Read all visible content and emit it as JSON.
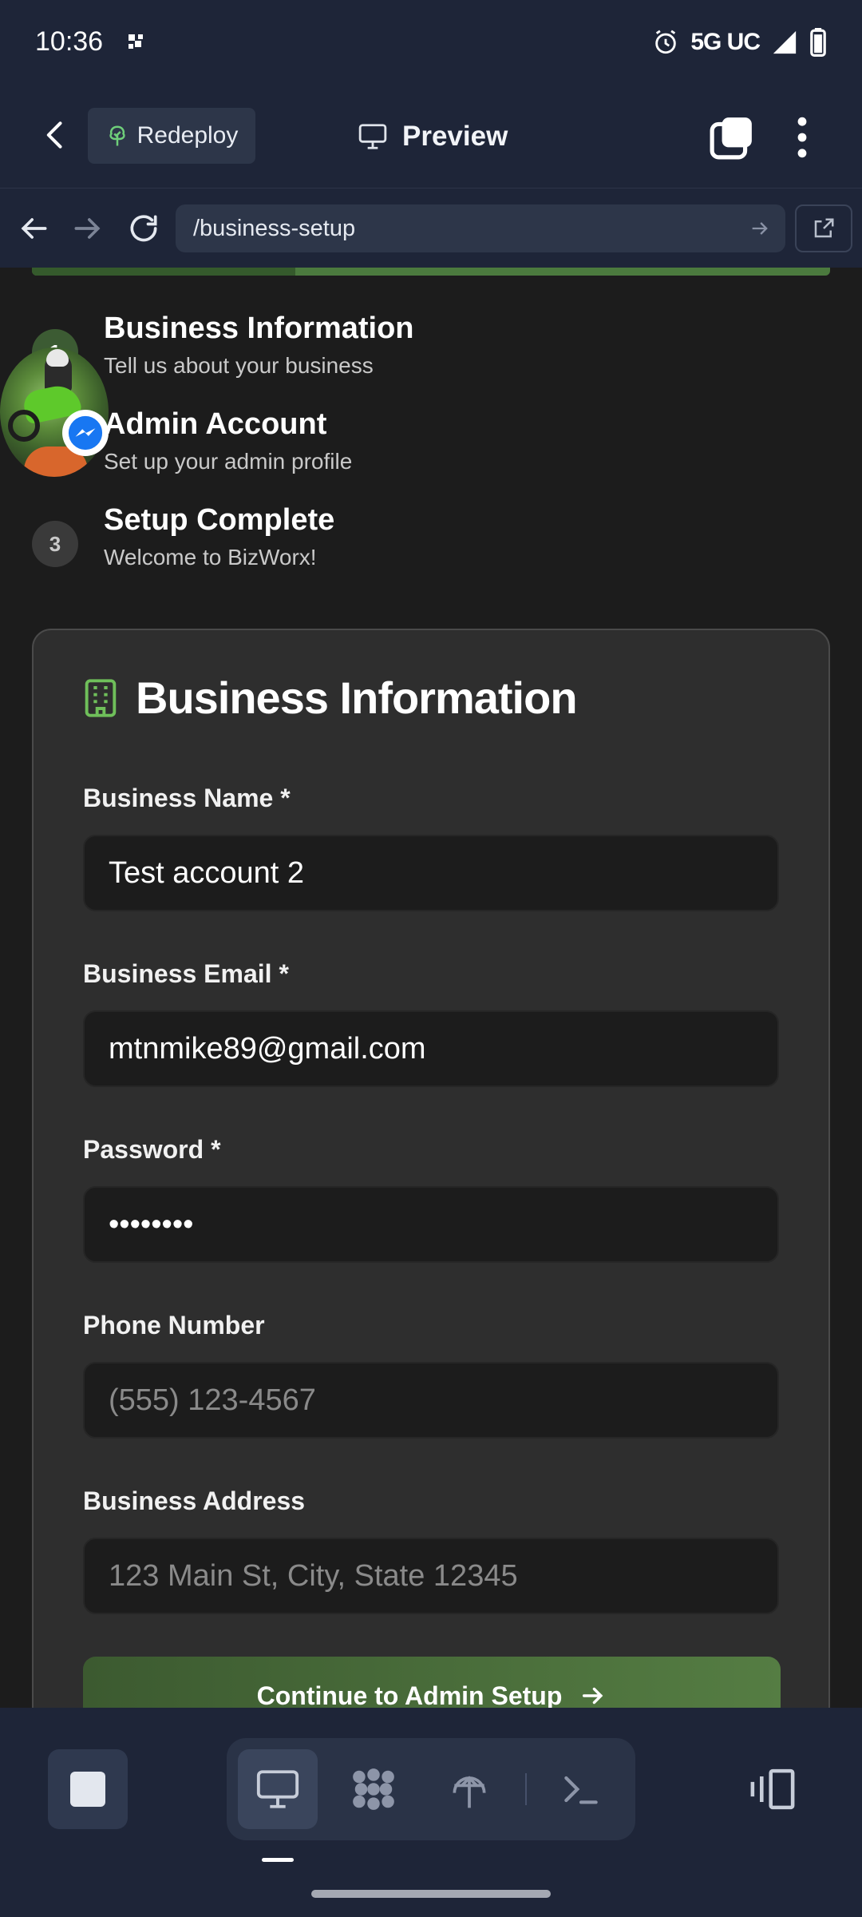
{
  "status_bar": {
    "time": "10:36",
    "network": "5G UC",
    "icons": [
      "notification-dot-icon",
      "alarm-icon",
      "signal-icon",
      "battery-icon"
    ]
  },
  "toolbar": {
    "redeploy_label": "Redeploy",
    "preview_label": "Preview"
  },
  "url_bar": {
    "url": "/business-setup"
  },
  "progress": {
    "fraction": 0.33
  },
  "steps": [
    {
      "number": "1",
      "title": "Business Information",
      "subtitle": "Tell us about your business"
    },
    {
      "number": "2",
      "title": "Admin Account",
      "subtitle": "Set up your admin profile"
    },
    {
      "number": "3",
      "title": "Setup Complete",
      "subtitle": "Welcome to BizWorx!"
    }
  ],
  "form": {
    "title": "Business Information",
    "fields": {
      "business_name": {
        "label": "Business Name *",
        "value": "Test account 2"
      },
      "business_email": {
        "label": "Business Email *",
        "value": "mtnmike89@gmail.com"
      },
      "password": {
        "label": "Password *",
        "value": "••••••••"
      },
      "phone": {
        "label": "Phone Number",
        "placeholder": "(555) 123-4567"
      },
      "address": {
        "label": "Business Address",
        "placeholder": "123 Main St, City, State 12345"
      }
    },
    "continue_label": "Continue to Admin Setup"
  },
  "colors": {
    "accent_green": "#557d43",
    "chrome_bg": "#1e2538",
    "card_bg": "#2e2e2e"
  }
}
